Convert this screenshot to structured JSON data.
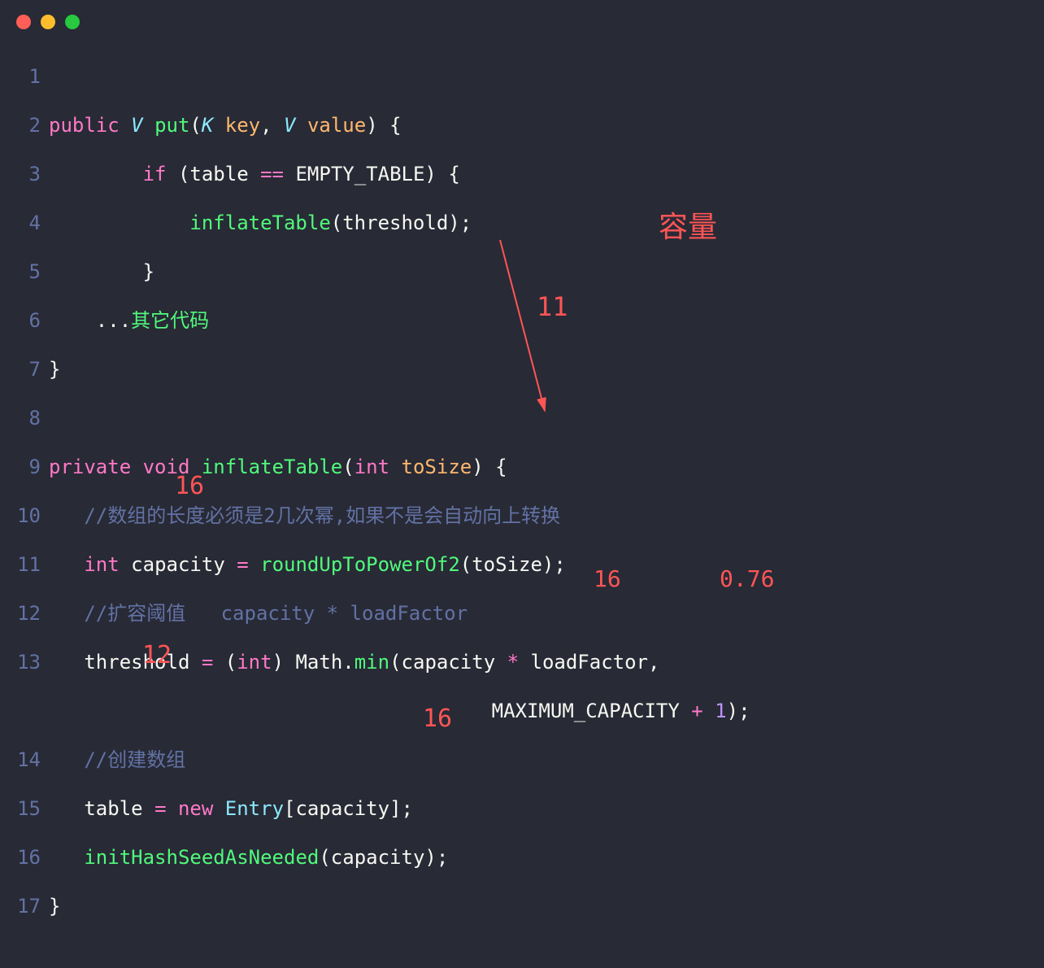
{
  "lines": {
    "1": "",
    "2": {
      "kw_public": "public",
      "type_v": "V",
      "method_put": "put",
      "type_k": "K",
      "param_key": "key",
      "comma": ",",
      "type_v2": "V",
      "param_value": "value",
      "close_paren": ")",
      "open_brace": "{"
    },
    "3": {
      "kw_if": "if",
      "open_paren": "(",
      "ident_table": "table",
      "op_eq": "==",
      "const_empty": "EMPTY_TABLE",
      "close_paren": ")",
      "open_brace": "{"
    },
    "4": {
      "method_inflate": "inflateTable",
      "open_paren": "(",
      "ident_threshold": "threshold",
      "close_paren": ")",
      "semicolon": ";"
    },
    "5": {
      "close_brace": "}"
    },
    "6": {
      "dots": "...",
      "comment": "其它代码"
    },
    "7": {
      "close_brace": "}"
    },
    "8": "",
    "9": {
      "kw_private": "private",
      "kw_void": "void",
      "method_inflate": "inflateTable",
      "open_paren": "(",
      "kw_int": "int",
      "param_tosize": "toSize",
      "close_paren": ")",
      "open_brace": "{"
    },
    "10": {
      "comment": "//数组的长度必须是2几次幂,如果不是会自动向上转换"
    },
    "11": {
      "kw_int": "int",
      "ident_capacity": "capacity",
      "op_assign": "=",
      "method_roundup": "roundUpToPowerOf2",
      "open_paren": "(",
      "ident_tosize": "toSize",
      "close_paren": ")",
      "semicolon": ";"
    },
    "12": {
      "comment": "//扩容阈值   capacity * loadFactor"
    },
    "13": {
      "ident_threshold": "threshold",
      "op_assign": "=",
      "open_paren": "(",
      "kw_int": "int",
      "close_paren": ")",
      "class_math": "Math",
      "dot": ".",
      "method_min": "min",
      "open_paren2": "(",
      "ident_capacity": "capacity",
      "op_mul": "*",
      "ident_loadfactor": "loadFactor",
      "comma": ","
    },
    "13b": {
      "const_max": "MAXIMUM_CAPACITY",
      "op_plus": "+",
      "num_1": "1",
      "close_paren": ")",
      "semicolon": ";"
    },
    "14": {
      "comment": "//创建数组"
    },
    "15": {
      "ident_table": "table",
      "op_assign": "=",
      "kw_new": "new",
      "type_entry": "Entry",
      "open_bracket": "[",
      "ident_capacity": "capacity",
      "close_bracket": "]",
      "semicolon": ";"
    },
    "16": {
      "method_init": "initHashSeedAsNeeded",
      "open_paren": "(",
      "ident_capacity": "capacity",
      "close_paren": ")",
      "semicolon": ";"
    },
    "17": {
      "close_brace": "}"
    }
  },
  "annotations": {
    "capacity_label": "容量",
    "arrow_value": "11",
    "sixteen_1": "16",
    "sixteen_2": "16",
    "zero76": "0.76",
    "twelve": "12",
    "sixteen_3": "16"
  },
  "line_numbers": [
    "1",
    "2",
    "3",
    "4",
    "5",
    "6",
    "7",
    "8",
    "9",
    "10",
    "11",
    "12",
    "13",
    "14",
    "15",
    "16",
    "17"
  ]
}
